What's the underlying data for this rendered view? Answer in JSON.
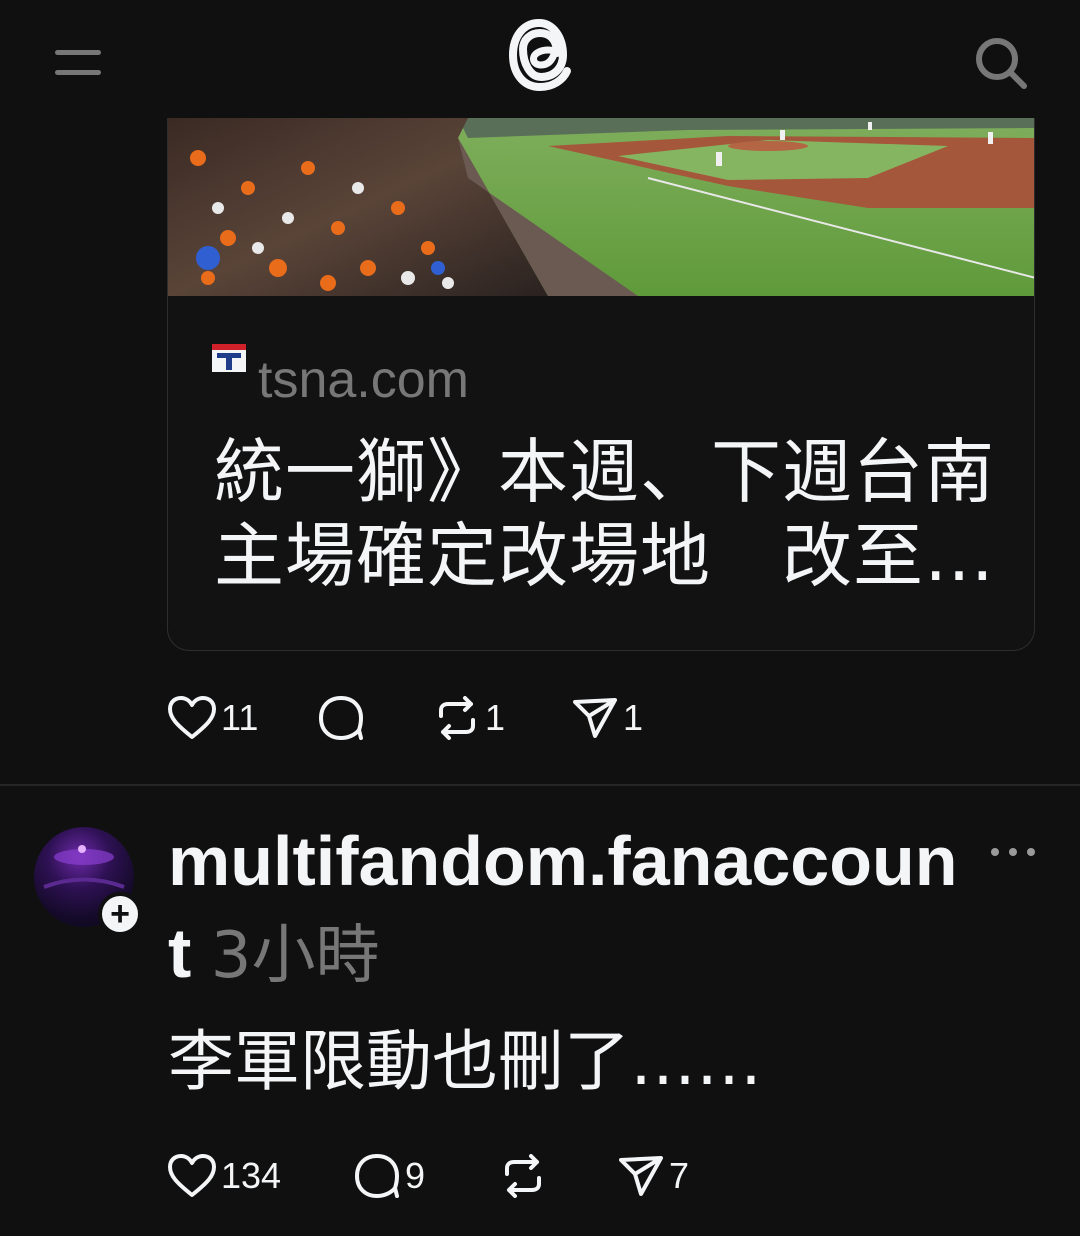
{
  "header": {
    "menu_icon": "hamburger-menu-icon",
    "logo_icon": "threads-logo-icon",
    "search_icon": "search-icon"
  },
  "link_card": {
    "image": "baseball-stadium-photo",
    "favicon_icon": "tsna-favicon-icon",
    "domain": "tsna.com",
    "title": "統一獅》本週、下週台南主場確定改場地　改至…"
  },
  "post1_actions": {
    "likes": "11",
    "replies": "",
    "reposts": "1",
    "shares": "1"
  },
  "post2": {
    "username": "multifandom.fanaccount",
    "time": "3小時",
    "text": "李軍限動也刪了……",
    "more_icon": "more-options-icon",
    "follow_icon": "plus-icon"
  },
  "post2_actions": {
    "likes": "134",
    "replies": "9",
    "reposts": "",
    "shares": "7"
  },
  "colors": {
    "background": "#101010",
    "text": "#f3f5f7",
    "secondary": "#777777",
    "border": "#2e2e2e"
  }
}
